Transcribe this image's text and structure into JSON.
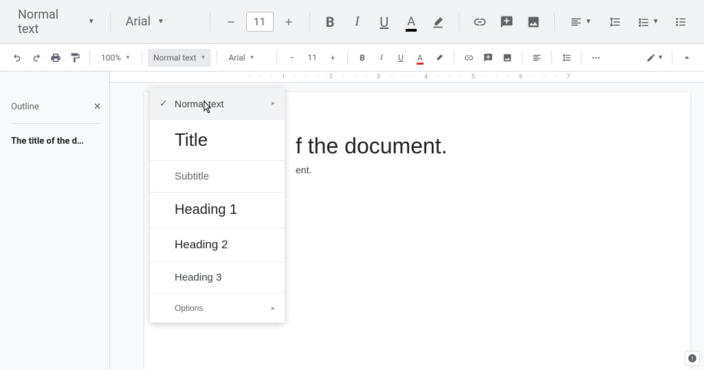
{
  "upper_toolbar": {
    "style_label": "Normal text",
    "font_label": "Arial",
    "font_size": "11"
  },
  "secondary_toolbar": {
    "zoom": "100%",
    "style_label": "Normal text",
    "font_label": "Arial",
    "font_size": "11"
  },
  "sidebar": {
    "outline_label": "Outline",
    "items": [
      {
        "label": "The title of the d…"
      }
    ]
  },
  "style_menu": {
    "items": [
      {
        "key": "normal",
        "label": "Normal text",
        "checked": true,
        "has_sub": true,
        "class": "style-normal",
        "hovered": true
      },
      {
        "key": "title",
        "label": "Title",
        "checked": false,
        "has_sub": false,
        "class": "style-title"
      },
      {
        "key": "subtitle",
        "label": "Subtitle",
        "checked": false,
        "has_sub": false,
        "class": "style-subtitle"
      },
      {
        "key": "h1",
        "label": "Heading 1",
        "checked": false,
        "has_sub": false,
        "class": "style-h1"
      },
      {
        "key": "h2",
        "label": "Heading 2",
        "checked": false,
        "has_sub": false,
        "class": "style-h2"
      },
      {
        "key": "h3",
        "label": "Heading 3",
        "checked": false,
        "has_sub": false,
        "class": "style-h3"
      },
      {
        "key": "options",
        "label": "Options",
        "checked": false,
        "has_sub": true,
        "class": "style-options"
      }
    ]
  },
  "document": {
    "title_fragment": "f the document.",
    "body_fragment": "ent."
  },
  "ruler_ticks": "· · · 1 · · · 2 · · · 3 · · · 4 · · · 5 · · · 6 · · · 7"
}
